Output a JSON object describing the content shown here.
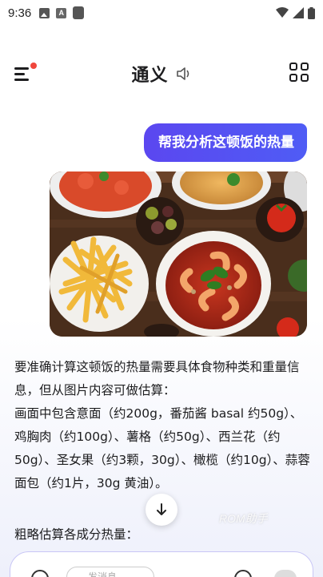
{
  "status_bar": {
    "time": "9:36"
  },
  "header": {
    "title": "通义"
  },
  "chat": {
    "user_message": "帮我分析这顿饭的热量",
    "answer_intro": "要准确计算这顿饭的热量需要具体食物种类和重量信息，但从图片内容可做估算：",
    "answer_detail": "画面中包含意面（约200g，番茄酱 basal 约50g）、鸡胸肉（约100g）、薯格（约50g）、西兰花（约50g）、圣女果（约3颗，30g）、橄榄（约10g）、蒜蓉面包（约1片，30g 黄油）。",
    "subheading": "粗略估算各成分热量："
  },
  "watermark": "ROM助手",
  "input": {
    "placeholder": "发消息..."
  },
  "colors": {
    "accent": "#5b47f0",
    "badge": "#f0463c"
  },
  "icons": [
    "menu-icon",
    "speaker-icon",
    "apps-grid-icon",
    "arrow-down-icon",
    "mic-icon"
  ]
}
